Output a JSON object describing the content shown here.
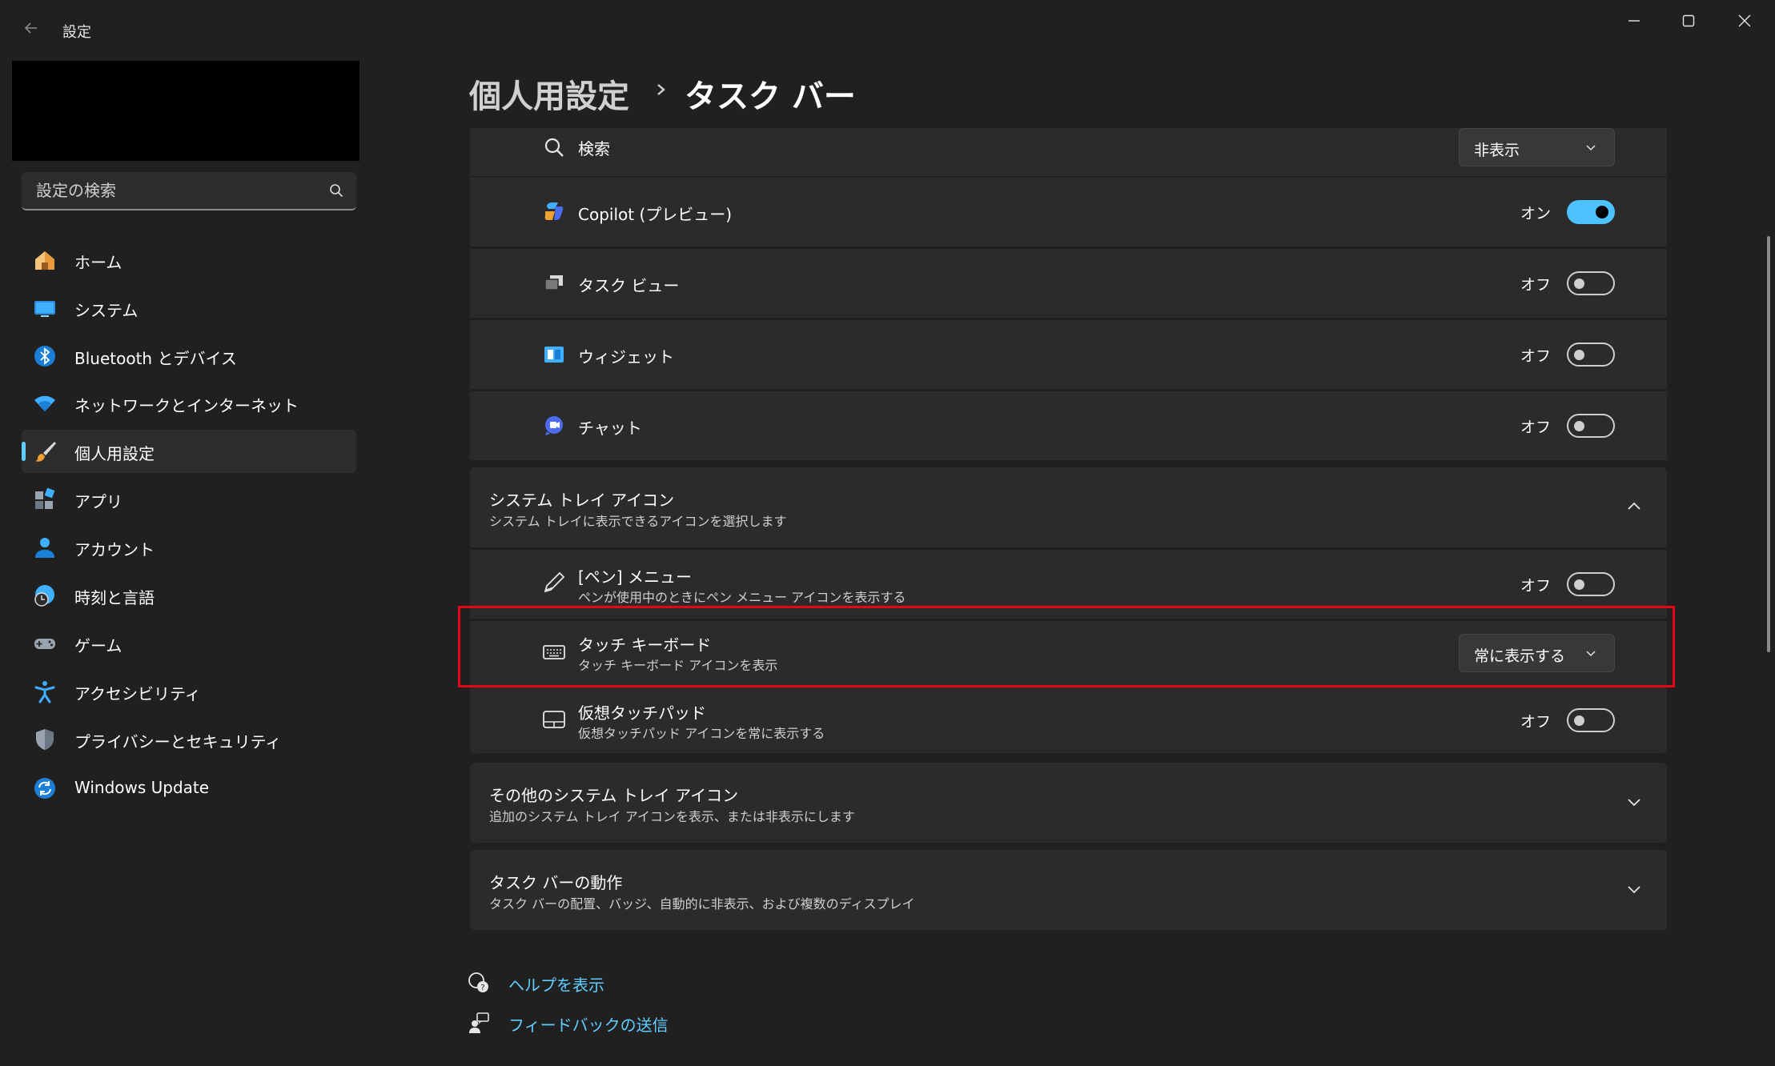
{
  "window": {
    "title": "設定",
    "back_icon": "arrow-left-icon",
    "controls": [
      "minimize-icon",
      "maximize-icon",
      "close-icon"
    ]
  },
  "search": {
    "placeholder": "設定の検索",
    "icon": "search-icon"
  },
  "sidebar": {
    "items": [
      {
        "label": "ホーム",
        "icon": "home-icon",
        "active": false
      },
      {
        "label": "システム",
        "icon": "monitor-icon",
        "active": false
      },
      {
        "label": "Bluetooth とデバイス",
        "icon": "bluetooth-icon",
        "active": false
      },
      {
        "label": "ネットワークとインターネット",
        "icon": "wifi-icon",
        "active": false
      },
      {
        "label": "個人用設定",
        "icon": "paintbrush-icon",
        "active": true
      },
      {
        "label": "アプリ",
        "icon": "apps-icon",
        "active": false
      },
      {
        "label": "アカウント",
        "icon": "person-icon",
        "active": false
      },
      {
        "label": "時刻と言語",
        "icon": "globe-clock-icon",
        "active": false
      },
      {
        "label": "ゲーム",
        "icon": "gamepad-icon",
        "active": false
      },
      {
        "label": "アクセシビリティ",
        "icon": "accessibility-icon",
        "active": false
      },
      {
        "label": "プライバシーとセキュリティ",
        "icon": "shield-icon",
        "active": false
      },
      {
        "label": "Windows Update",
        "icon": "sync-icon",
        "active": false
      }
    ]
  },
  "header": {
    "parent": "個人用設定",
    "separator_icon": "chevron-right-icon",
    "current": "タスク バー"
  },
  "taskbar_items": {
    "search": {
      "label": "検索",
      "icon": "search-icon",
      "value": "非表示"
    },
    "copilot": {
      "label": "Copilot (プレビュー)",
      "icon": "copilot-icon",
      "state": "オン",
      "on": true
    },
    "task_view": {
      "label": "タスク ビュー",
      "icon": "task-view-icon",
      "state": "オフ",
      "on": false
    },
    "widgets": {
      "label": "ウィジェット",
      "icon": "widgets-icon",
      "state": "オフ",
      "on": false
    },
    "chat": {
      "label": "チャット",
      "icon": "chat-icon",
      "state": "オフ",
      "on": false
    }
  },
  "system_tray": {
    "title": "システム トレイ アイコン",
    "subtitle": "システム トレイに表示できるアイコンを選択します",
    "expanded": true,
    "pen_menu": {
      "label": "[ペン] メニュー",
      "sub": "ペンが使用中のときにペン メニュー アイコンを表示する",
      "icon": "pen-icon",
      "state": "オフ",
      "on": false
    },
    "touch_keyboard": {
      "label": "タッチ キーボード",
      "sub": "タッチ キーボード アイコンを表示",
      "icon": "keyboard-icon",
      "value": "常に表示する",
      "highlighted": true,
      "highlight_color": "#e30613"
    },
    "touchpad": {
      "label": "仮想タッチパッド",
      "sub": "仮想タッチパッド アイコンを常に表示する",
      "icon": "touchpad-icon",
      "state": "オフ",
      "on": false
    }
  },
  "other_tray": {
    "title": "その他のシステム トレイ アイコン",
    "subtitle": "追加のシステム トレイ アイコンを表示、または非表示にします"
  },
  "behaviors": {
    "title": "タスク バーの動作",
    "subtitle": "タスク バーの配置、バッジ、自動的に非表示、および複数のディスプレイ"
  },
  "footer": {
    "help": "ヘルプを表示",
    "help_icon": "help-chat-icon",
    "feedback": "フィードバックの送信",
    "feedback_icon": "feedback-icon"
  },
  "colors": {
    "background": "#202020",
    "card": "#2b2b2b",
    "accent": "#4cc2ff",
    "link": "#60cdff",
    "highlight": "#e30613"
  }
}
